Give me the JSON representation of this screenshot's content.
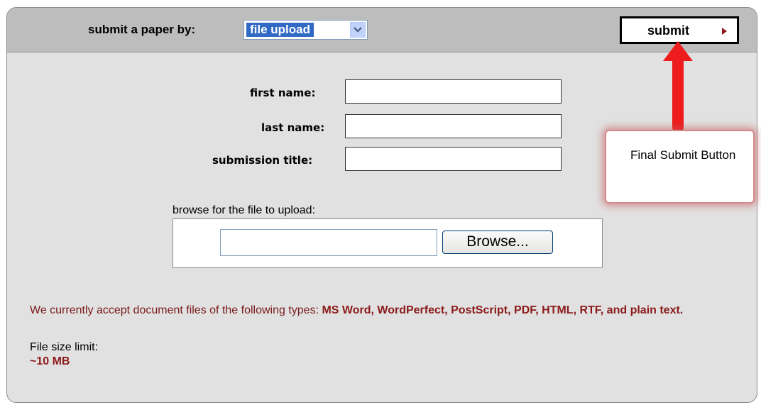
{
  "header": {
    "submit_by_label": "submit a paper by:",
    "method_select": {
      "selected": "file upload"
    },
    "submit_button": {
      "label": "submit"
    }
  },
  "form": {
    "first_name": {
      "label": "first name:",
      "value": ""
    },
    "last_name": {
      "label": "last name:",
      "value": ""
    },
    "submission_title": {
      "label": "submission title:",
      "value": ""
    }
  },
  "upload": {
    "caption": "browse for the file to upload:",
    "file_path": "",
    "browse_button": "Browse..."
  },
  "info": {
    "accept_prefix": "We currently accept document files of the following types: ",
    "accept_types": "MS Word, WordPerfect, PostScript, PDF, HTML, RTF, and plain text.",
    "size_label": "File size limit:",
    "size_value": "~10 MB"
  },
  "annotation": {
    "text": "Final Submit Button"
  },
  "colors": {
    "panel_bg": "#e1e1e1",
    "header_bg": "#bdbdbd",
    "accent_dark_red": "#8b1a1a",
    "select_highlight": "#316ac5",
    "annotation_arrow": "#ee1c1c"
  },
  "icons": {
    "select_dropdown": "chevron-down-icon",
    "submit_arrow": "triangle-right-icon",
    "annotation": "arrow-up-icon"
  }
}
